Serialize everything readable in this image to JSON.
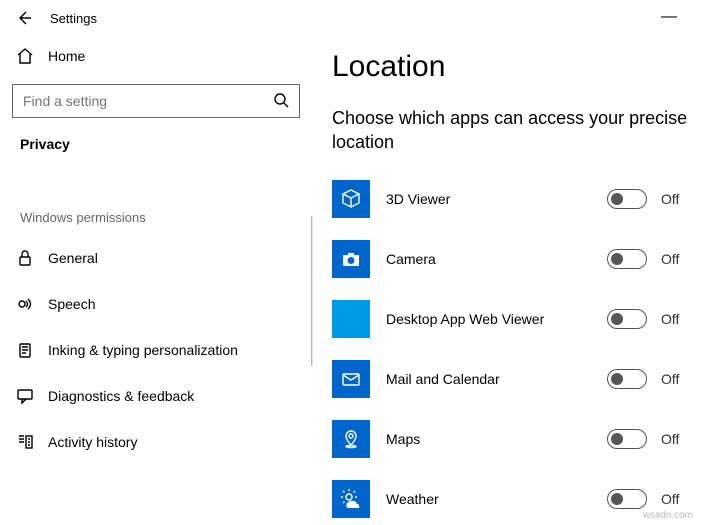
{
  "window": {
    "title": "Settings",
    "minimize": "—"
  },
  "sidebar": {
    "home": "Home",
    "search_placeholder": "Find a setting",
    "active_section": "Privacy",
    "group_label": "Windows permissions",
    "items": [
      {
        "label": "General"
      },
      {
        "label": "Speech"
      },
      {
        "label": "Inking & typing personalization"
      },
      {
        "label": "Diagnostics & feedback"
      },
      {
        "label": "Activity history"
      }
    ]
  },
  "page": {
    "title": "Location",
    "subtitle": "Choose which apps can access your precise location",
    "apps": [
      {
        "name": "3D Viewer",
        "state": "Off"
      },
      {
        "name": "Camera",
        "state": "Off"
      },
      {
        "name": "Desktop App Web Viewer",
        "state": "Off"
      },
      {
        "name": "Mail and Calendar",
        "state": "Off"
      },
      {
        "name": "Maps",
        "state": "Off"
      },
      {
        "name": "Weather",
        "state": "Off"
      }
    ]
  },
  "watermark": "wsxdn.com"
}
